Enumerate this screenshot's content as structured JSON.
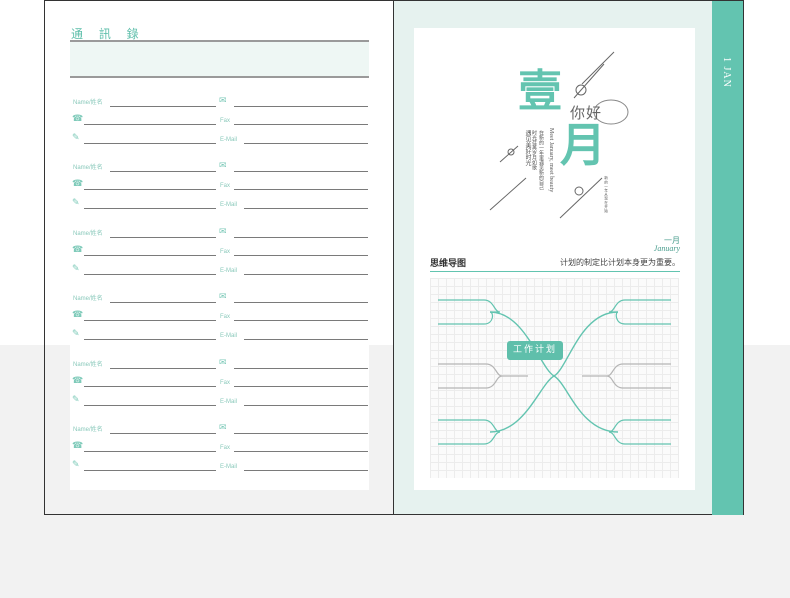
{
  "left_page": {
    "title": "通 訊 錄",
    "entries": [
      {
        "name_label": "Name/姓名",
        "fax_label": "Fax",
        "email_label": "E-Mail"
      },
      {
        "name_label": "Name/姓名",
        "fax_label": "Fax",
        "email_label": "E-Mail"
      },
      {
        "name_label": "Name/姓名",
        "fax_label": "Fax",
        "email_label": "E-Mail"
      },
      {
        "name_label": "Name/姓名",
        "fax_label": "Fax",
        "email_label": "E-Mail"
      },
      {
        "name_label": "Name/姓名",
        "fax_label": "Fax",
        "email_label": "E-Mail"
      },
      {
        "name_label": "Name/姓名",
        "fax_label": "Fax",
        "email_label": "E-Mail"
      }
    ],
    "icons": [
      "envelope-icon",
      "phone-icon",
      "pen-icon"
    ]
  },
  "right_page": {
    "tab_label": "1 JAN",
    "hero": {
      "char_one": "壹",
      "char_month": "月",
      "hello": "你好",
      "english": "Meet January, meet beauty",
      "line_a": "遇见美好时光",
      "line_b": "时光荏苒岁月如歌",
      "line_c": "在新的一年里遇见新的自己",
      "small_text": "新的一年从现在开始"
    },
    "month_cn": "一月",
    "month_en": "January",
    "mindmap_title": "思维导图",
    "mindmap_subtitle": "计划的制定比计划本身更为重要。",
    "center_label": "工作计划"
  },
  "colors": {
    "accent": "#63c4b0",
    "light_accent": "#e6f2ef",
    "rule": "#7a7a7a",
    "grey_branch": "#b5b5b5"
  }
}
